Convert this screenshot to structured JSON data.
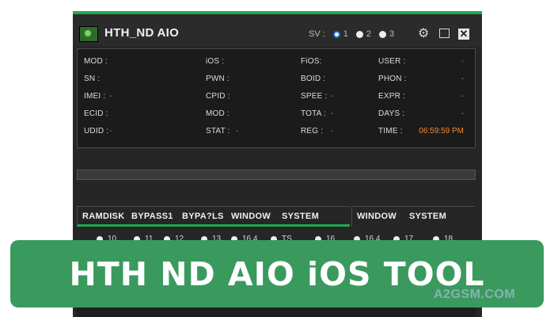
{
  "window": {
    "title": "HTH_ND AIO"
  },
  "sv": {
    "label": "SV :",
    "options": [
      "1",
      "2",
      "3"
    ],
    "selected": "1"
  },
  "info": {
    "rows": [
      [
        {
          "label": "MOD :",
          "value": ""
        },
        {
          "label": "iOS :",
          "value": ""
        },
        {
          "label": "FiOS:",
          "value": ""
        },
        {
          "label": "USER :",
          "value": "-"
        }
      ],
      [
        {
          "label": "SN :",
          "value": ""
        },
        {
          "label": "PWN :",
          "value": ""
        },
        {
          "label": "BOID :",
          "value": ""
        },
        {
          "label": "PHON :",
          "value": "-"
        }
      ],
      [
        {
          "label": "IMEI :",
          "value": "-"
        },
        {
          "label": "CPID :",
          "value": ""
        },
        {
          "label": "SPEE :",
          "value": "-"
        },
        {
          "label": "EXPR :",
          "value": "-"
        }
      ],
      [
        {
          "label": "ECID :",
          "value": ""
        },
        {
          "label": "MOD :",
          "value": ""
        },
        {
          "label": "TOTA :",
          "value": "-"
        },
        {
          "label": "DAYS :",
          "value": "-"
        }
      ],
      [
        {
          "label": "UDID :",
          "value": "-"
        },
        {
          "label": "STAT :",
          "value": "-"
        },
        {
          "label": "REG :",
          "value": "-"
        },
        {
          "label": "TIME :",
          "value": "06:59:59 PM"
        }
      ]
    ]
  },
  "tabs_left": [
    "RAMDISK",
    "BYPASS1",
    "BYPA?LS",
    "WINDOW",
    "SYSTEM"
  ],
  "tabs_right": [
    "WINDOW",
    "SYSTEM"
  ],
  "versions": [
    "10",
    "11",
    "12",
    "13",
    "16.4",
    "TS",
    "16",
    "16.4",
    "17",
    "18"
  ],
  "banner": {
    "text": "HTH ND AIO iOS TOOL"
  },
  "watermark": "A2GSM.COM",
  "colors": {
    "accent": "#1faa4e",
    "banner": "#3a9a5e",
    "value": "#e25a2a",
    "time": "#f08a2a"
  }
}
